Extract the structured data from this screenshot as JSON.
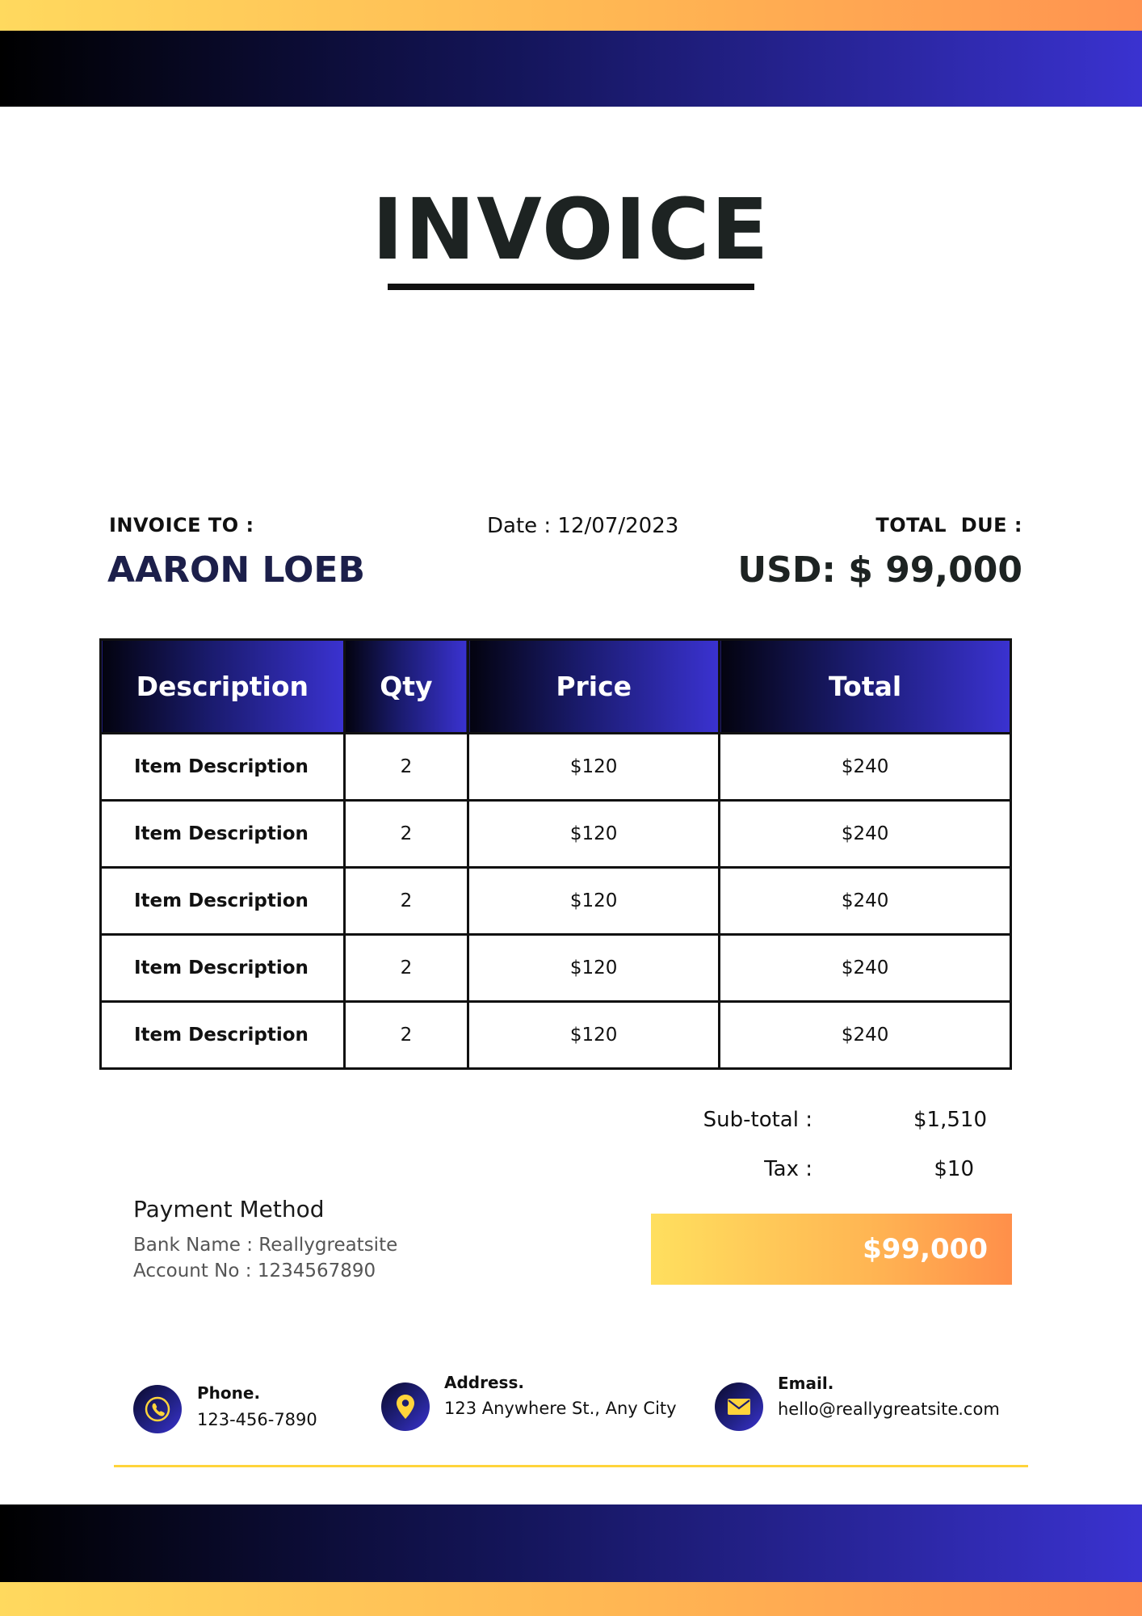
{
  "document": {
    "title": "INVOICE",
    "invoice_to_label": "INVOICE TO :",
    "client_name": "AARON LOEB",
    "date_line": "Date : 12/07/2023",
    "total_due_label": "TOTAL  DUE :",
    "total_due_value": "USD: $ 99,000"
  },
  "table": {
    "headers": [
      "Description",
      "Qty",
      "Price",
      "Total"
    ],
    "rows": [
      {
        "description": "Item Description",
        "qty": "2",
        "price": "$120",
        "total": "$240"
      },
      {
        "description": "Item Description",
        "qty": "2",
        "price": "$120",
        "total": "$240"
      },
      {
        "description": "Item Description",
        "qty": "2",
        "price": "$120",
        "total": "$240"
      },
      {
        "description": "Item Description",
        "qty": "2",
        "price": "$120",
        "total": "$240"
      },
      {
        "description": "Item Description",
        "qty": "2",
        "price": "$120",
        "total": "$240"
      }
    ]
  },
  "summary": {
    "subtotal_label": "Sub-total :",
    "subtotal_value": "$1,510",
    "tax_label": "Tax :",
    "tax_value": "$10",
    "grand_total": "$99,000"
  },
  "payment": {
    "title": "Payment Method",
    "bank_line": "Bank Name : Reallygreatsite",
    "account_line": "Account No : 1234567890"
  },
  "contacts": {
    "phone_label": "Phone.",
    "phone_value": "123-456-7890",
    "phone_icon": "phone-icon",
    "address_label": "Address.",
    "address_value": "123 Anywhere St., Any City",
    "address_icon": "location-pin-icon",
    "email_label": "Email.",
    "email_value": "hello@reallygreatsite.com",
    "email_icon": "envelope-icon"
  },
  "colors": {
    "navy_dark": "#000000",
    "navy_mid": "#14155a",
    "royal_blue": "#3a32d0",
    "orange_light": "#ffd95e",
    "orange_dark": "#ff9350",
    "icon_yellow": "#ffd43b",
    "rule_yellow": "#ffd43b"
  }
}
